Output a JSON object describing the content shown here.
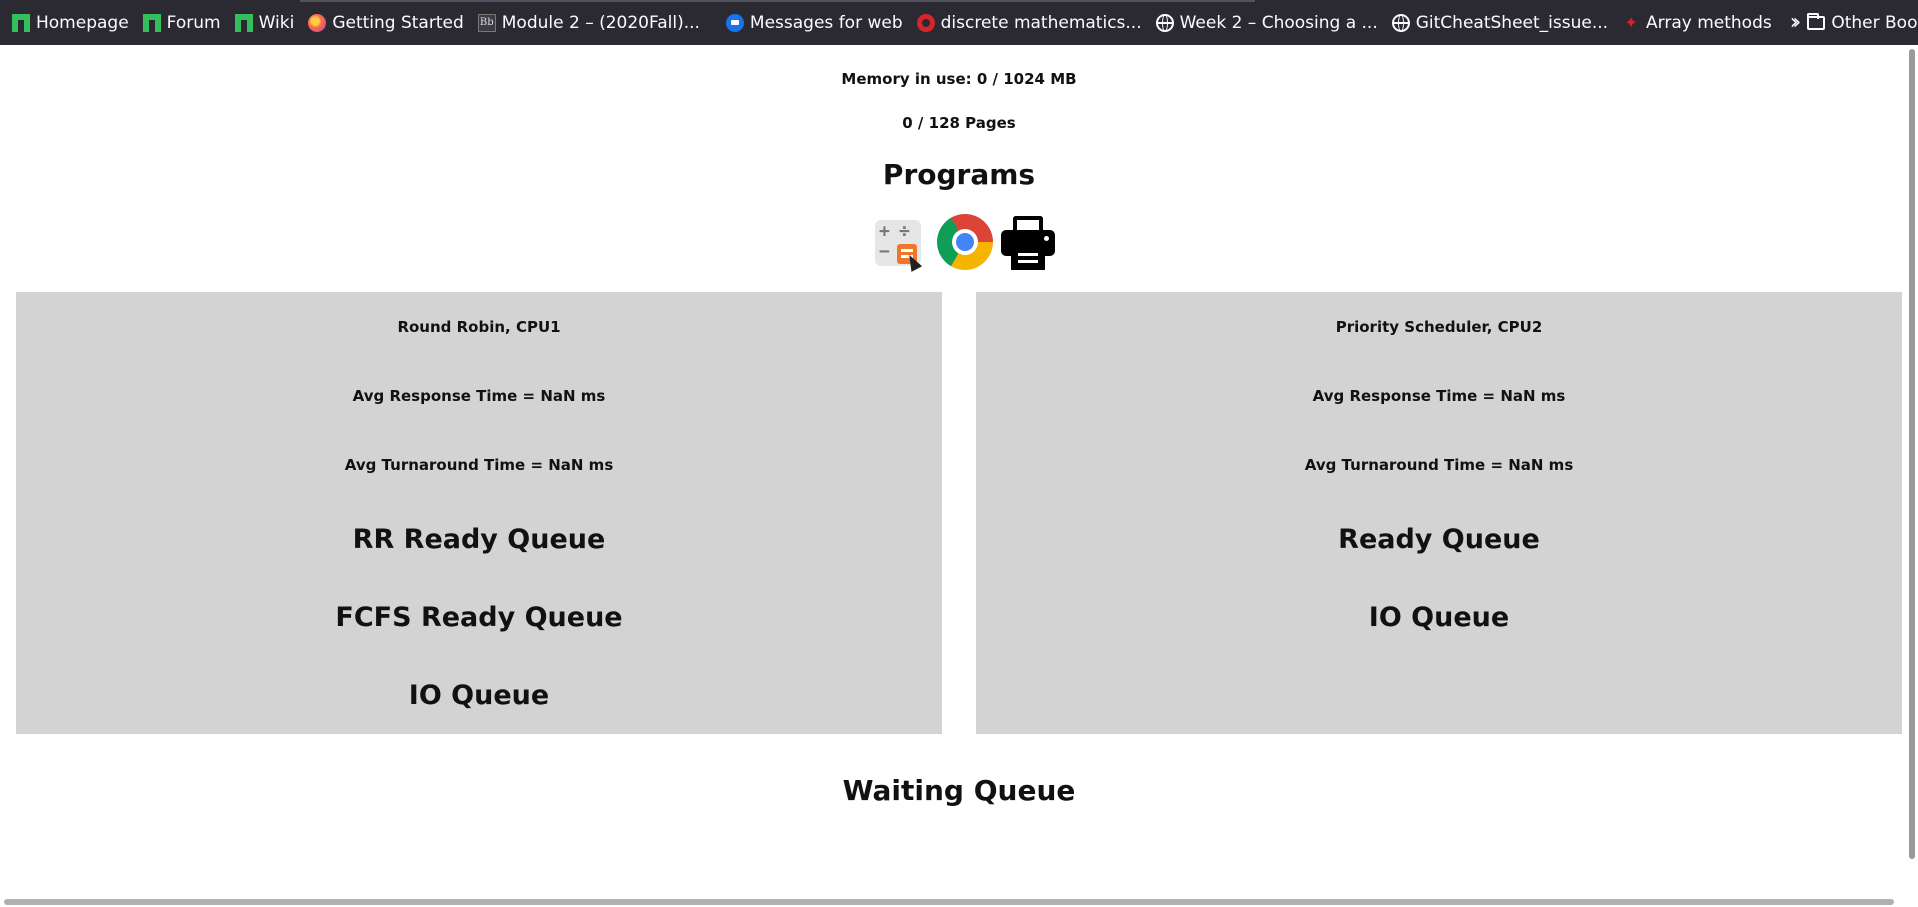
{
  "bookmarks": {
    "items": [
      {
        "label": "Homepage",
        "icon": "manjaro-icon"
      },
      {
        "label": "Forum",
        "icon": "manjaro-icon"
      },
      {
        "label": "Wiki",
        "icon": "manjaro-icon"
      },
      {
        "label": "Getting Started",
        "icon": "firefox-icon"
      },
      {
        "label": "Module 2 – (2020Fall)...",
        "icon": "blackboard-icon"
      },
      {
        "label": "Messages for web",
        "icon": "messages-icon"
      },
      {
        "label": "discrete mathematics...",
        "icon": "gear-red-icon"
      },
      {
        "label": "Week 2 – Choosing a ...",
        "icon": "globe-icon"
      },
      {
        "label": "GitCheatSheet_issue...",
        "icon": "globe-icon"
      },
      {
        "label": "Array methods",
        "icon": "figure-icon"
      }
    ],
    "other_label": "Other Bookmarks",
    "bb_glyph": "Bb"
  },
  "memory": {
    "text": "Memory in use: 0 / 1024 MB"
  },
  "pages": {
    "text": "0 / 128 Pages"
  },
  "programs": {
    "title": "Programs",
    "items": [
      "calculator-icon",
      "chrome-icon",
      "printer-icon"
    ]
  },
  "cpu1": {
    "title": "Round Robin, CPU1",
    "avg_response": "Avg Response Time = NaN ms",
    "avg_turnaround": "Avg Turnaround Time = NaN ms",
    "queues": [
      "RR Ready Queue",
      "FCFS Ready Queue",
      "IO Queue"
    ]
  },
  "cpu2": {
    "title": "Priority Scheduler, CPU2",
    "avg_response": "Avg Response Time = NaN ms",
    "avg_turnaround": "Avg Turnaround Time = NaN ms",
    "queues": [
      "Ready Queue",
      "IO Queue"
    ]
  },
  "waiting": {
    "title": "Waiting Queue"
  },
  "colors": {
    "toolbar_bg": "#2b2a33",
    "panel_bg": "#d3d3d3"
  }
}
